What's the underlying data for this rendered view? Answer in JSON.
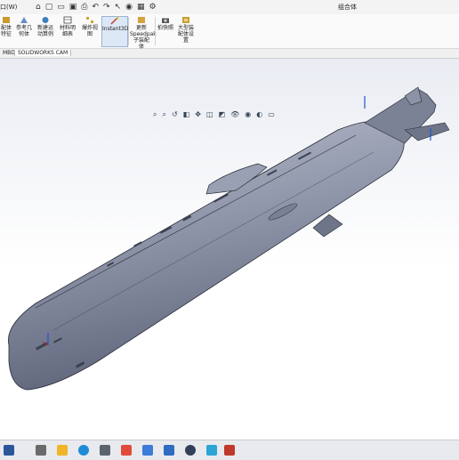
{
  "titlebar": {
    "menu_text": "口(W)",
    "document_title": "组合体"
  },
  "quick_access": [
    {
      "name": "home-icon",
      "glyph": "⌂"
    },
    {
      "name": "new-file-icon",
      "glyph": "▢"
    },
    {
      "name": "open-folder-icon",
      "glyph": "▭"
    },
    {
      "name": "save-icon",
      "glyph": "▣"
    },
    {
      "name": "print-icon",
      "glyph": "⎙"
    },
    {
      "name": "undo-icon",
      "glyph": "↶"
    },
    {
      "name": "redo-icon",
      "glyph": "↷"
    },
    {
      "name": "select-pointer-icon",
      "glyph": "↖"
    },
    {
      "name": "traffic-light-icon",
      "glyph": "◉"
    },
    {
      "name": "options-grid-icon",
      "glyph": "▦"
    },
    {
      "name": "settings-gear-icon",
      "glyph": "⚙"
    }
  ],
  "ribbon": {
    "items": [
      {
        "label": "配体\n特征",
        "name": "assembly-feature-button"
      },
      {
        "label": "参考几\n何体",
        "name": "reference-geometry-button"
      },
      {
        "label": "新建运\n动算例",
        "name": "new-motion-study-button"
      },
      {
        "label": "材料明\n细表",
        "name": "bom-button"
      },
      {
        "label": "爆炸视\n图",
        "name": "exploded-view-button"
      },
      {
        "label": "Instant3D",
        "name": "instant3d-button"
      },
      {
        "label": "更新\nSpeedpak\n子装配\n体",
        "name": "update-speedpak-button"
      },
      {
        "label": "拍快照",
        "name": "snapshot-button"
      },
      {
        "label": "大型装\n配体设\n置",
        "name": "large-assembly-settings-button"
      }
    ]
  },
  "tabs": [
    {
      "label": "MBD",
      "name": "tab-mbd"
    },
    {
      "label": "SOLIDWORKS CAM",
      "name": "tab-solidworks-cam"
    }
  ],
  "colors": {
    "hull": "#8f95a8",
    "hull_dark": "#555b70",
    "hull_light": "#b4b9c8",
    "edge": "#2a2d38",
    "active_tab": "#dde8f6"
  }
}
